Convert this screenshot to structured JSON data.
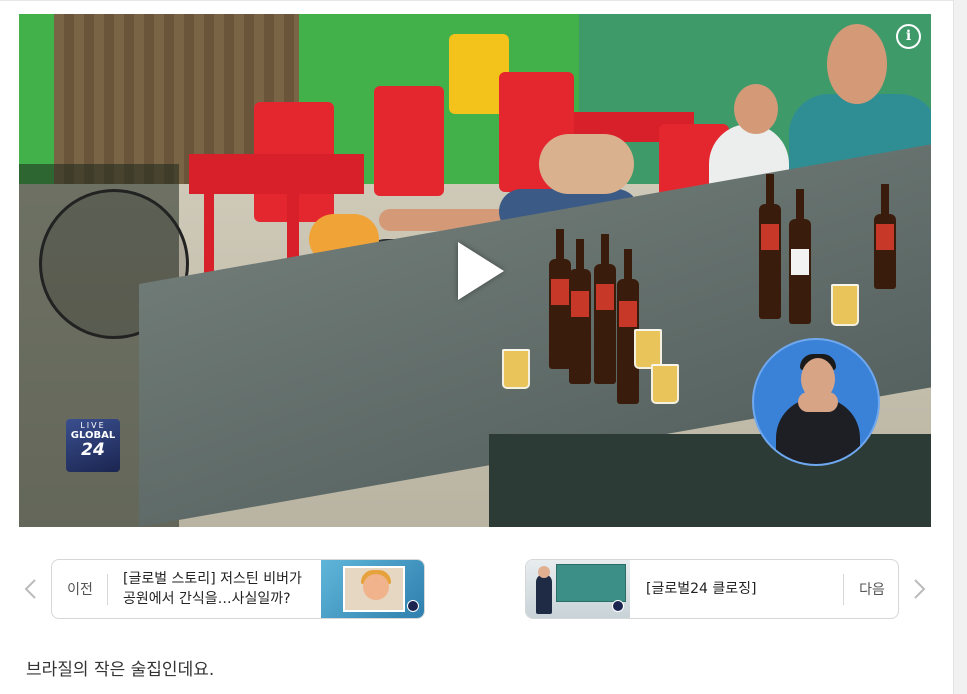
{
  "player": {
    "info_icon": "info-icon",
    "play_icon": "play-icon",
    "live_badge": {
      "tag": "LIVE",
      "name": "GLOBAL",
      "number": "24"
    }
  },
  "navigation": {
    "prev": {
      "direction_label": "이전",
      "title_line1": "[글로벌 스토리] 저스틴 비버가",
      "title_line2": "공원에서 간식을…사실일까?",
      "arrow_icon": "chevron-left-icon"
    },
    "next": {
      "direction_label": "다음",
      "title_line1": "[글로벌24 클로징]",
      "arrow_icon": "chevron-right-icon"
    }
  },
  "article": {
    "caption": "브라질의 작은 술집인데요."
  },
  "colors": {
    "arrow": "#bbbbbb",
    "card_border": "#d7d7d7",
    "sign_language_bg": "#3a82d8"
  }
}
